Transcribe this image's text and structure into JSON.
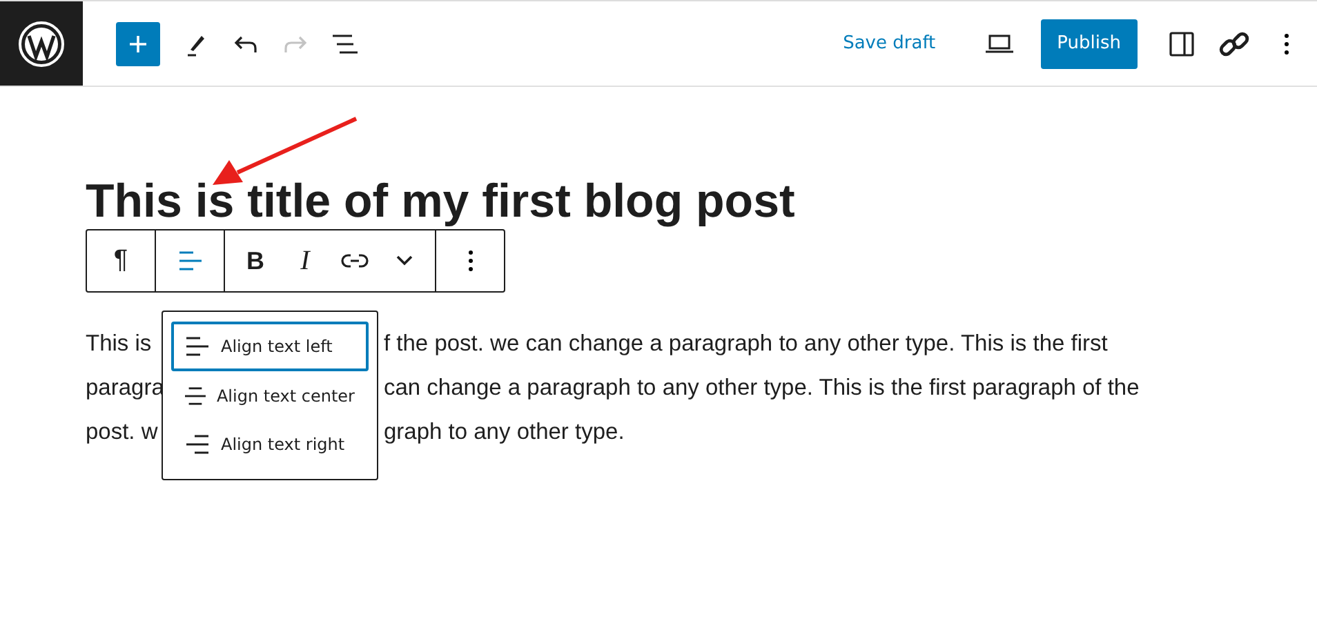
{
  "header": {
    "save_draft": "Save draft",
    "publish": "Publish",
    "redo": {
      "disabled": true
    }
  },
  "post": {
    "title": "This is title of my first blog post",
    "paragraph_lines": [
      {
        "left": "This is ",
        "right": "f the post. we can change a paragraph to any other type. This is the first"
      },
      {
        "left": "paragra",
        "right": "can change a paragraph to any other type. This is the first paragraph of the"
      },
      {
        "left": "post. w",
        "right": "graph to any other type."
      }
    ]
  },
  "block_toolbar": {
    "paragraph_mark": "¶",
    "align": {
      "expanded": true
    },
    "bold": "B",
    "italic": "I"
  },
  "align_menu": [
    {
      "label": "Align text left",
      "kind": "left",
      "selected": true
    },
    {
      "label": "Align text center",
      "kind": "center",
      "selected": false
    },
    {
      "label": "Align text right",
      "kind": "right",
      "selected": false
    }
  ]
}
